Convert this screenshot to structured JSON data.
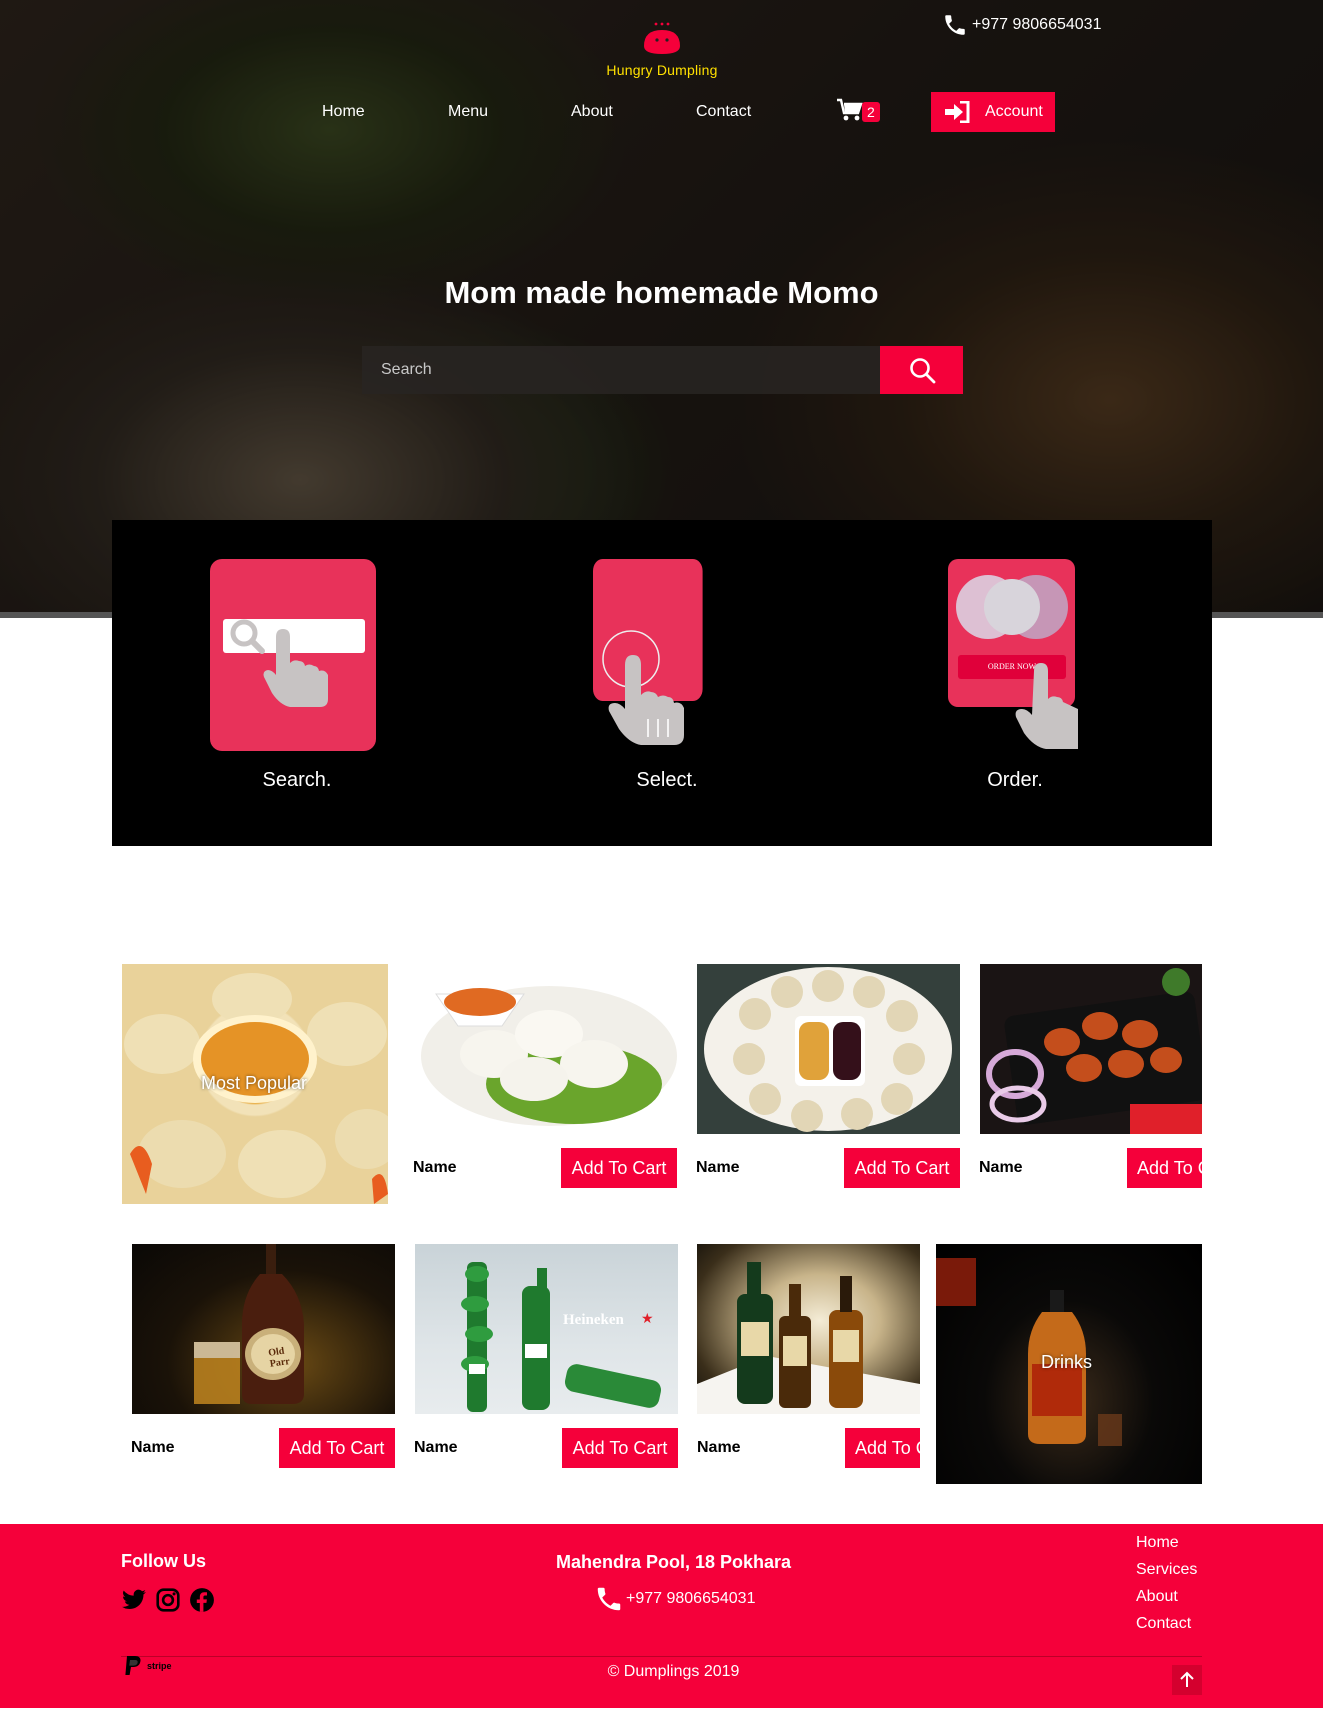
{
  "brand": {
    "name": "Hungry Dumpling",
    "phone": "+977 9806654031"
  },
  "nav": {
    "items": [
      "Home",
      "Menu",
      "About",
      "Contact"
    ],
    "cart_count": "2",
    "account_label": "Account"
  },
  "hero": {
    "title": "Mom made homemade Momo",
    "search_placeholder": "Search"
  },
  "steps": [
    {
      "label": "Search."
    },
    {
      "label": "Select."
    },
    {
      "label": "Order.",
      "button_text": "ORDER NOW"
    }
  ],
  "products": {
    "food_feature_label": "Most Popular",
    "drinks_feature_label": "Drinks",
    "name_label": "Name",
    "add_label": "Add To Cart",
    "drink_image_texts": {
      "heineken": "Heineken",
      "old_parr": "Old Parr"
    }
  },
  "footer": {
    "follow_title": "Follow Us",
    "address": "Mahendra Pool, 18 Pokhara",
    "phone": "+977 9806654031",
    "links": [
      "Home",
      "Services",
      "About",
      "Contact"
    ],
    "copyright": "© Dumplings 2019",
    "payment_text": "stripe"
  },
  "colors": {
    "accent": "#f5003a",
    "brand_yellow": "#ffe000",
    "step_tile": "#e8325a"
  },
  "icons": [
    "phone-icon",
    "cart-icon",
    "login-icon",
    "search-icon",
    "twitter-icon",
    "instagram-icon",
    "facebook-icon",
    "paypal-icon",
    "arrow-up-icon"
  ]
}
